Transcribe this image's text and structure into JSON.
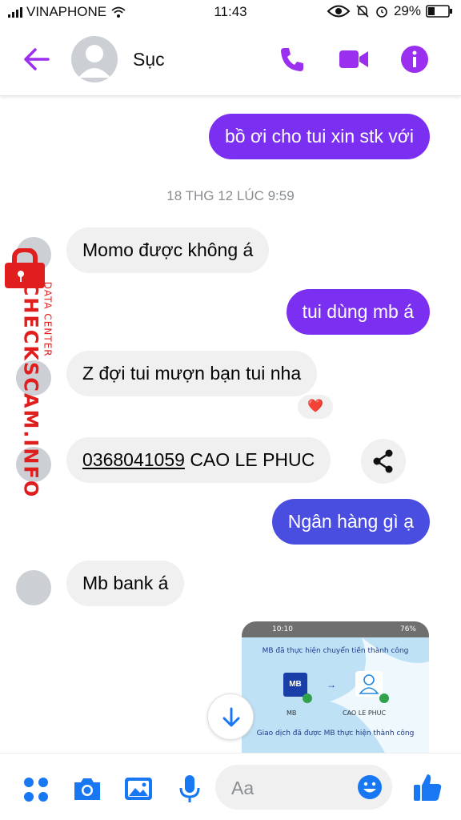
{
  "status_bar": {
    "carrier": "VINAPHONE",
    "time": "11:43",
    "battery": "29%"
  },
  "header": {
    "contact_name": "Sục",
    "icons": [
      "back-arrow-icon",
      "phone-icon",
      "video-icon",
      "info-icon"
    ]
  },
  "messages": [
    {
      "dir": "out",
      "text": "bồ ơi cho tui xin stk với"
    },
    {
      "dir": "timestamp",
      "text": "18 THG 12 LÚC 9:59"
    },
    {
      "dir": "in",
      "text": "Momo được không á"
    },
    {
      "dir": "out",
      "text": "tui dùng mb á"
    },
    {
      "dir": "in",
      "text": "Z đợi tui mượn bạn tui nha",
      "reaction": "❤️"
    },
    {
      "dir": "in",
      "account_number": "0368041059",
      "account_name": "CAO LE PHUC"
    },
    {
      "dir": "out",
      "text": "Ngân hàng gì ạ"
    },
    {
      "dir": "in",
      "text": "Mb bank á"
    }
  ],
  "image_preview": {
    "status_time": "10:10",
    "status_battery": "76%",
    "success_title": "MB đã thực hiện chuyển tiền thành công",
    "source_logo": "MB",
    "source_label": "MB",
    "recipient_label": "CAO LE PHUC",
    "footer_text": "Giao dịch đã được MB thực hiện thành công"
  },
  "watermark": {
    "small_text": "DATA CENTER",
    "big_text": "CHECKSCAM.INFO"
  },
  "composer": {
    "placeholder": "Aa",
    "icons": [
      "menu-grid-icon",
      "camera-icon",
      "gallery-icon",
      "microphone-icon",
      "emoji-icon",
      "thumbs-up-icon"
    ]
  },
  "colors": {
    "accent": "#9b2ff0",
    "outgoing_bubble": "#7b2ff0",
    "outgoing_bubble_late": "#4a4ee0",
    "incoming_bubble": "#f0f0f0",
    "composer_icon": "#1877f2",
    "watermark": "#e01e1e"
  }
}
